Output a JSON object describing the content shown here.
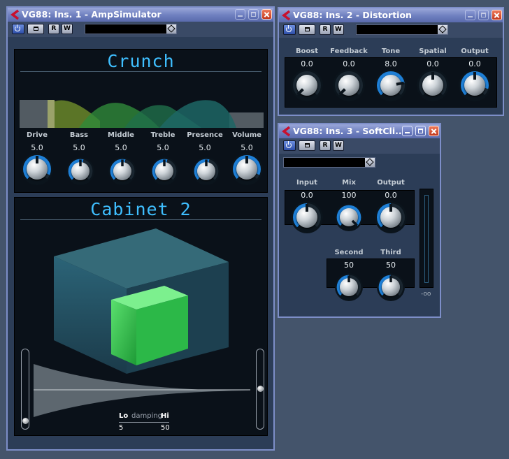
{
  "background": "#44546b",
  "ampsim": {
    "title": "VG88: Ins. 1 - AmpSimulator",
    "toolbar": {
      "read": "R",
      "write": "W"
    },
    "amp_header": "Crunch",
    "knobs": [
      {
        "label": "Drive",
        "value": "5.0"
      },
      {
        "label": "Bass",
        "value": "5.0"
      },
      {
        "label": "Middle",
        "value": "5.0"
      },
      {
        "label": "Treble",
        "value": "5.0"
      },
      {
        "label": "Presence",
        "value": "5.0"
      },
      {
        "label": "Volume",
        "value": "5.0"
      }
    ],
    "cabinet_header": "Cabinet 2",
    "damping": {
      "lo_label": "Lo",
      "mid_label": "damping",
      "hi_label": "Hi",
      "lo_value": "5",
      "hi_value": "50"
    }
  },
  "distortion": {
    "title": "VG88: Ins. 2 - Distortion",
    "toolbar": {
      "read": "R",
      "write": "W"
    },
    "knobs": [
      {
        "label": "Boost",
        "value": "0.0"
      },
      {
        "label": "Feedback",
        "value": "0.0"
      },
      {
        "label": "Tone",
        "value": "8.0"
      },
      {
        "label": "Spatial",
        "value": "0.0"
      },
      {
        "label": "Output",
        "value": "0.0"
      }
    ]
  },
  "softclip": {
    "title": "VG88: Ins. 3 - SoftCli...",
    "toolbar": {
      "read": "R",
      "write": "W"
    },
    "knobs": [
      {
        "label": "Input",
        "value": "0.0"
      },
      {
        "label": "Mix",
        "value": "100"
      },
      {
        "label": "Output",
        "value": "0.0"
      }
    ],
    "harmonics": [
      {
        "label": "Second",
        "value": "50"
      },
      {
        "label": "Third",
        "value": "50"
      }
    ],
    "meter_label": "-oo"
  },
  "colors": {
    "accent_blue": "#1e7fd6",
    "display_text": "#3fbfff",
    "cube_green": "#3cd25a"
  }
}
